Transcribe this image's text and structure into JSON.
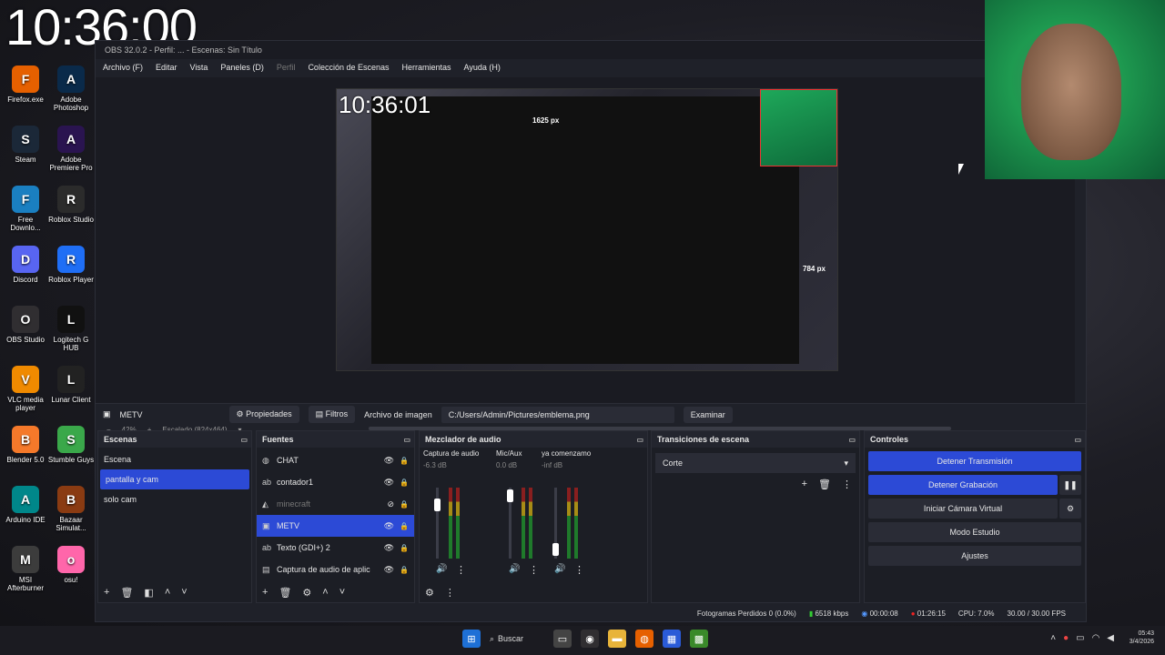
{
  "overlay_clock": "10:36:00",
  "desktop_icons": [
    {
      "label": "Firefox.exe",
      "icon": "firefox-icon",
      "color": "#e66000"
    },
    {
      "label": "Adobe Photoshop",
      "icon": "photoshop-icon",
      "color": "#0a2a4a"
    },
    {
      "label": "Steam",
      "icon": "steam-icon",
      "color": "#1b2838"
    },
    {
      "label": "Adobe Premiere Pro",
      "icon": "premiere-icon",
      "color": "#2a1450"
    },
    {
      "label": "Free Downlo...",
      "icon": "download-icon",
      "color": "#1a7fc1"
    },
    {
      "label": "Roblox Studio",
      "icon": "roblox-studio-icon",
      "color": "#2b2b2b"
    },
    {
      "label": "Discord",
      "icon": "discord-icon",
      "color": "#5865f2"
    },
    {
      "label": "Roblox Player",
      "icon": "roblox-player-icon",
      "color": "#1f6ef5"
    },
    {
      "label": "OBS Studio",
      "icon": "obs-icon",
      "color": "#302e31"
    },
    {
      "label": "Logitech G HUB",
      "icon": "logitech-icon",
      "color": "#111111"
    },
    {
      "label": "VLC media player",
      "icon": "vlc-icon",
      "color": "#f08a00"
    },
    {
      "label": "Lunar Client",
      "icon": "lunar-icon",
      "color": "#222222"
    },
    {
      "label": "Blender 5.0",
      "icon": "blender-icon",
      "color": "#f5792a"
    },
    {
      "label": "Stumble Guys",
      "icon": "stumble-icon",
      "color": "#3aa84a"
    },
    {
      "label": "Arduino IDE",
      "icon": "arduino-icon",
      "color": "#00878a"
    },
    {
      "label": "Bazaar Simulat...",
      "icon": "bazaar-icon",
      "color": "#8a3b12"
    },
    {
      "label": "MSI Afterburner",
      "icon": "msi-icon",
      "color": "#3c3c3c"
    },
    {
      "label": "osu!",
      "icon": "osu-icon",
      "color": "#ff66aa"
    }
  ],
  "obs": {
    "title": "OBS 32.0.2 - Perfil: ... - Escenas: Sin Título",
    "menu": [
      "Archivo (F)",
      "Editar",
      "Vista",
      "Paneles (D)",
      "Perfil",
      "Colección de Escenas",
      "Herramientas",
      "Ayuda (H)"
    ],
    "preview_clock": "10:36:01",
    "px_width_label": "1625 px",
    "px_height_label": "784 px",
    "zoom": "42%",
    "scale_label": "Escalado (824x464)",
    "selected_source_label": "METV",
    "props_button": "Propiedades",
    "filters_button": "Filtros",
    "image_file_label": "Archivo de imagen",
    "image_path": "C:/Users/Admin/Pictures/emblema.png",
    "browse_button": "Examinar",
    "scenes": {
      "title": "Escenas",
      "items": [
        "Escena",
        "pantalla y cam",
        "solo cam"
      ],
      "selected": 1
    },
    "sources": {
      "title": "Fuentes",
      "items": [
        {
          "name": "CHAT",
          "icon": "browser-icon",
          "visible": true
        },
        {
          "name": "contador1",
          "icon": "text-icon",
          "visible": true
        },
        {
          "name": "minecraft",
          "icon": "game-capture-icon",
          "visible": false
        },
        {
          "name": "METV",
          "icon": "image-icon",
          "visible": true
        },
        {
          "name": "Texto (GDI+) 2",
          "icon": "text-icon",
          "visible": true
        },
        {
          "name": "Captura de audio de aplic",
          "icon": "audio-capture-icon",
          "visible": true
        }
      ],
      "selected": 3
    },
    "mixer": {
      "title": "Mezclador de audio",
      "channels": [
        {
          "name": "Captura de audio c",
          "db": "-6.3 dB",
          "level": 0.82
        },
        {
          "name": "Mic/Aux",
          "db": "0.0 dB",
          "level": 0.97
        },
        {
          "name": "ya comenzamo",
          "db": "-inf dB",
          "level": 0.05
        }
      ],
      "scale": [
        "0",
        "-5",
        "-10",
        "-15",
        "-20",
        "-25",
        "-30",
        "-35",
        "-40",
        "-45",
        "-50",
        "-55",
        "-60"
      ]
    },
    "transitions": {
      "title": "Transiciones de escena",
      "selected": "Corte"
    },
    "controls": {
      "title": "Controles",
      "stop_stream": "Detener Transmisión",
      "stop_record": "Detener Grabación",
      "virtual_cam": "Iniciar Cámara Virtual",
      "studio_mode": "Modo Estudio",
      "settings": "Ajustes"
    },
    "status": {
      "dropped_frames": "Fotogramas Perdidos 0 (0.0%)",
      "bitrate": "6518 kbps",
      "stream_time": "00:00:08",
      "rec_time": "01:26:15",
      "cpu": "CPU: 7.0%",
      "fps": "30.00 / 30.00 FPS"
    }
  },
  "taskbar": {
    "search": "Buscar",
    "time": "05:43",
    "date": "3/4/2026"
  },
  "colors": {
    "accent": "#2c4ad6",
    "panel": "#1c1e25",
    "green_screen": "#1e9a50"
  }
}
